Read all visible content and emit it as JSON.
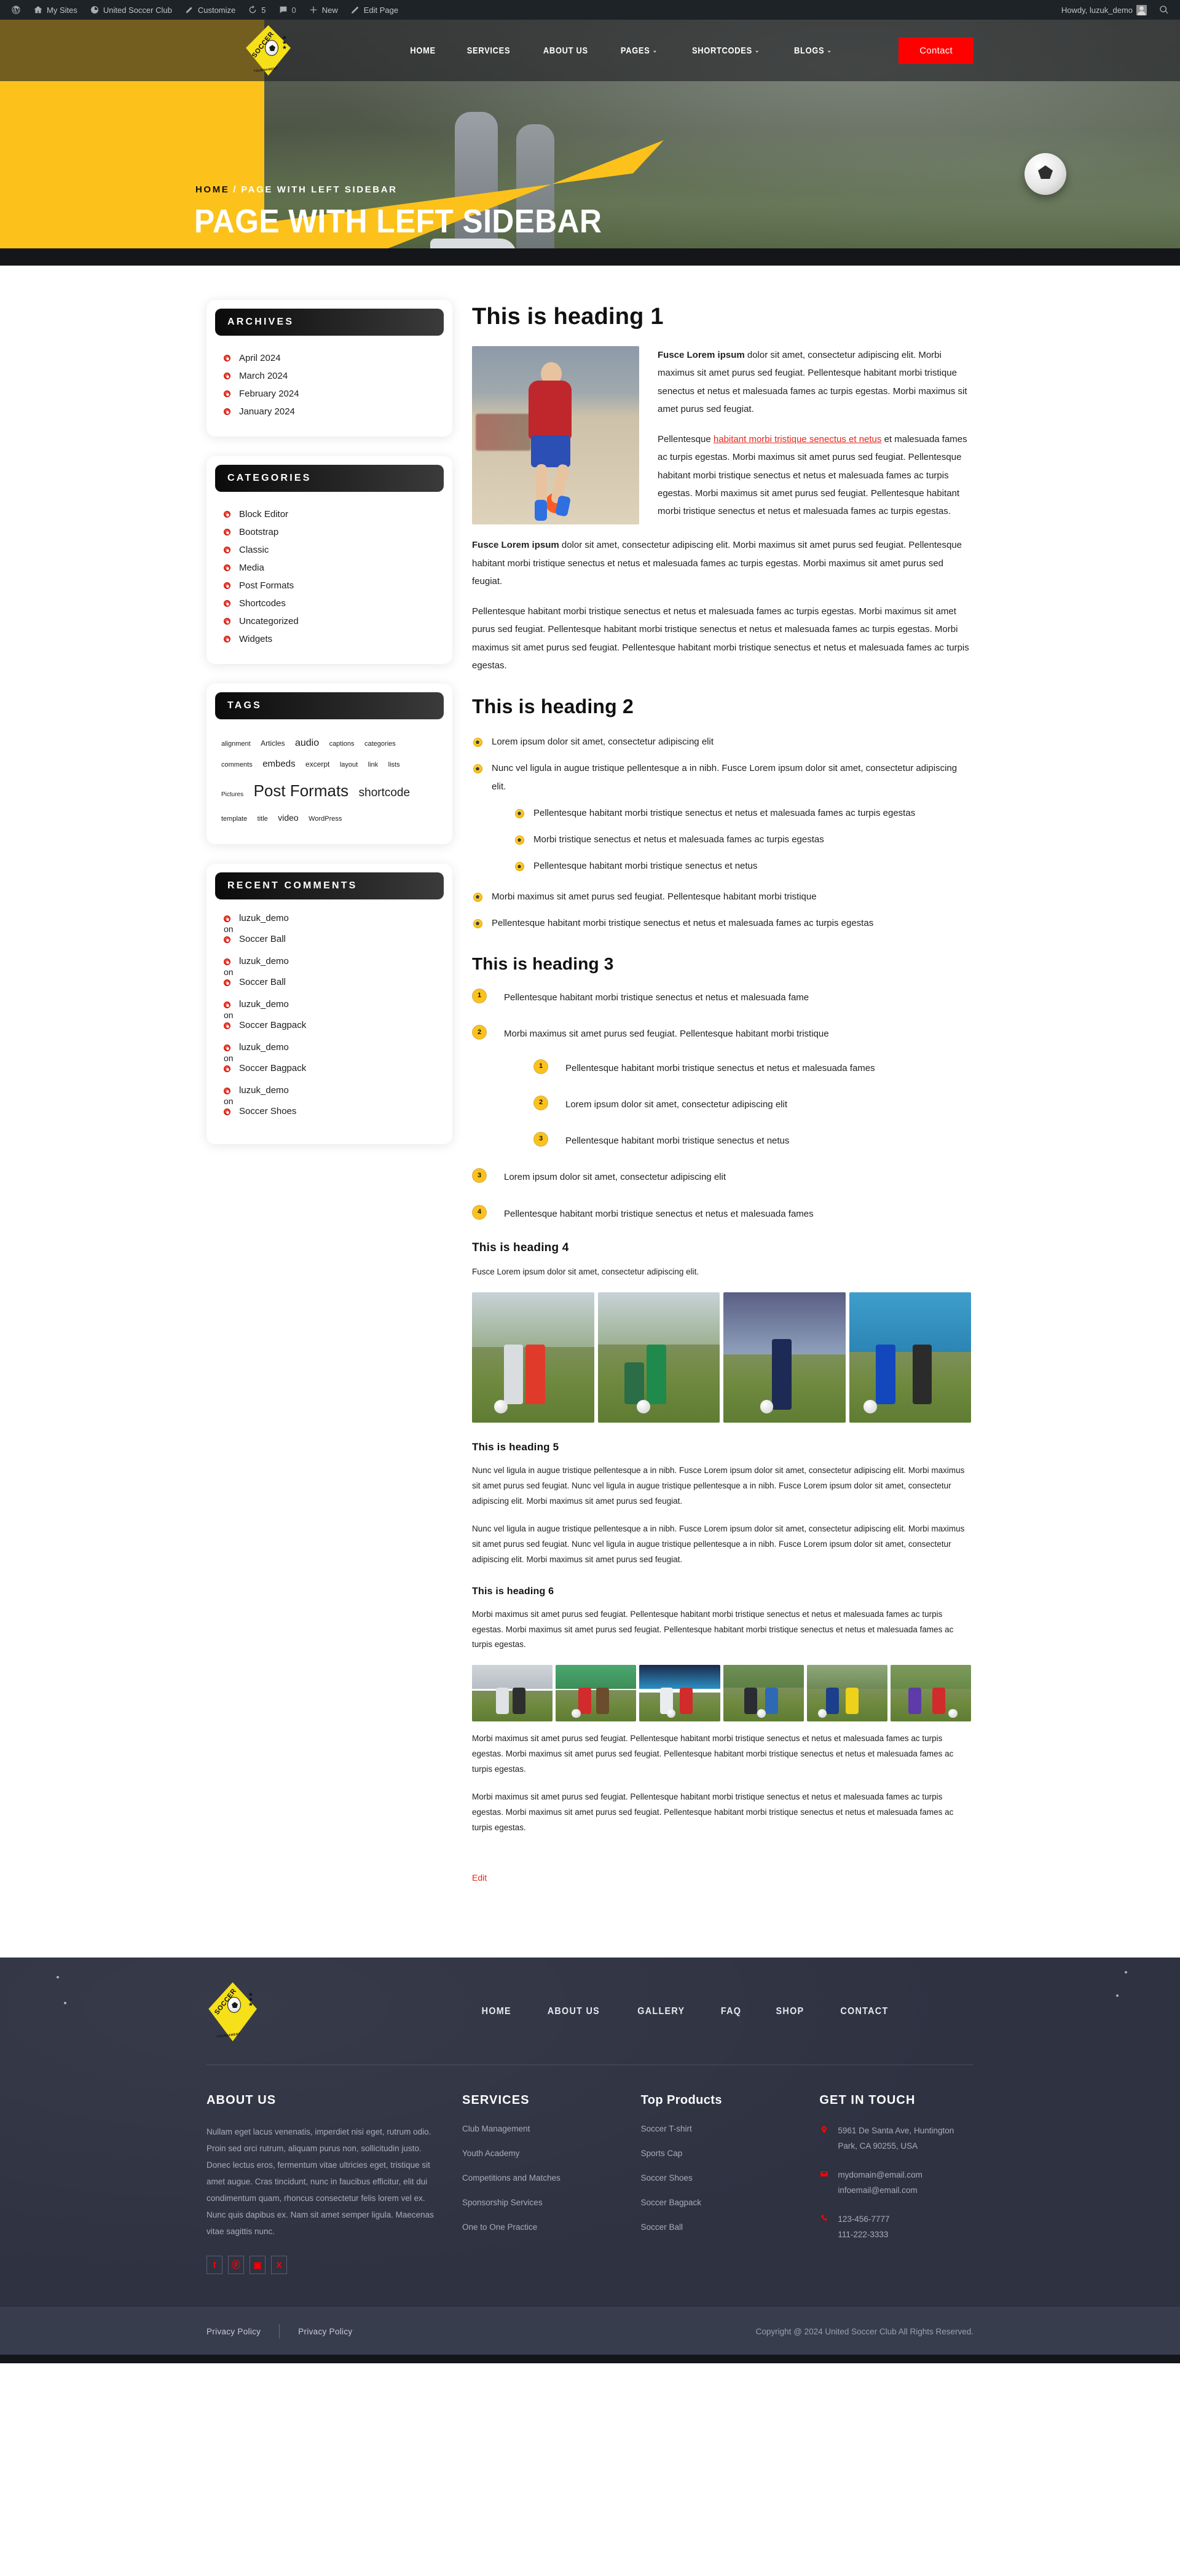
{
  "adminbar": {
    "items": [
      {
        "icon": "wordpress-icon",
        "label": ""
      },
      {
        "icon": "sites-icon",
        "label": "My Sites"
      },
      {
        "icon": "dashboard-icon",
        "label": "United Soccer Club"
      },
      {
        "icon": "customize-icon",
        "label": "Customize"
      },
      {
        "icon": "updates-icon",
        "label": "5"
      },
      {
        "icon": "comments-icon",
        "label": "0"
      },
      {
        "icon": "plus-icon",
        "label": "New"
      },
      {
        "icon": "edit-icon",
        "label": "Edit Page"
      }
    ],
    "howdy": "Howdy, luzuk_demo",
    "search_icon": "search-icon"
  },
  "header": {
    "logo_word": "SOCCER",
    "logo_sub": "TOURNAMENT",
    "nav": [
      {
        "label": "HOME",
        "has_caret": false
      },
      {
        "label": "SERVICES",
        "has_caret": false
      },
      {
        "label": "ABOUT US",
        "has_caret": false
      },
      {
        "label": "PAGES",
        "has_caret": true
      },
      {
        "label": "SHORTCODES",
        "has_caret": true
      },
      {
        "label": "BLOGS",
        "has_caret": true
      }
    ],
    "contact_button": "Contact",
    "accent_red": "#ff0000",
    "accent_yellow": "#fcc21b"
  },
  "hero": {
    "breadcrumb_home": "HOME",
    "breadcrumb_sep": "/",
    "breadcrumb_current": "PAGE WITH LEFT SIDEBAR",
    "title": "PAGE WITH LEFT SIDEBAR"
  },
  "sidebar": {
    "widgets": [
      {
        "title": "ARCHIVES",
        "type": "list",
        "items": [
          "April 2024",
          "March 2024",
          "February 2024",
          "January 2024"
        ]
      },
      {
        "title": "CATEGORIES",
        "type": "list",
        "items": [
          "Block Editor",
          "Bootstrap",
          "Classic",
          "Media",
          "Post Formats",
          "Shortcodes",
          "Uncategorized",
          "Widgets"
        ]
      },
      {
        "title": "TAGS",
        "type": "tagcloud",
        "tags": [
          {
            "label": "alignment",
            "size": 11
          },
          {
            "label": "Articles",
            "size": 12
          },
          {
            "label": "audio",
            "size": 16
          },
          {
            "label": "captions",
            "size": 11
          },
          {
            "label": "categories",
            "size": 11
          },
          {
            "label": "comments",
            "size": 11
          },
          {
            "label": "embeds",
            "size": 15
          },
          {
            "label": "excerpt",
            "size": 12
          },
          {
            "label": "layout",
            "size": 11
          },
          {
            "label": "link",
            "size": 11
          },
          {
            "label": "lists",
            "size": 11
          },
          {
            "label": "Pictures",
            "size": 10
          },
          {
            "label": "Post Formats",
            "size": 26
          },
          {
            "label": "shortcode",
            "size": 19
          },
          {
            "label": "template",
            "size": 11
          },
          {
            "label": "title",
            "size": 11
          },
          {
            "label": "video",
            "size": 14
          },
          {
            "label": "WordPress",
            "size": 11
          }
        ]
      },
      {
        "title": "RECENT COMMENTS",
        "type": "comments",
        "on_word": "on",
        "items": [
          {
            "author": "luzuk_demo",
            "post": "Soccer Ball"
          },
          {
            "author": "luzuk_demo",
            "post": "Soccer Ball"
          },
          {
            "author": "luzuk_demo",
            "post": "Soccer Bagpack"
          },
          {
            "author": "luzuk_demo",
            "post": "Soccer Bagpack"
          },
          {
            "author": "luzuk_demo",
            "post": "Soccer Shoes"
          }
        ]
      }
    ]
  },
  "content": {
    "h1": "This is heading 1",
    "intro_p1_strong": "Fusce Lorem ipsum",
    "intro_p1_rest": " dolor sit amet, consectetur adipiscing elit. Morbi maximus sit amet purus sed feugiat. Pellentesque habitant morbi tristique senectus et netus et malesuada fames ac turpis egestas. Morbi maximus sit amet purus sed feugiat.",
    "intro_p2_a": "Pellentesque ",
    "intro_p2_link": "habitant morbi tristique senectus et netus",
    "intro_p2_b": " et malesuada fames ac turpis egestas. Morbi maximus sit amet purus sed feugiat. Pellentesque habitant morbi tristique senectus et netus et malesuada fames ac turpis egestas. Morbi maximus sit amet purus sed feugiat. Pellentesque habitant morbi tristique senectus et netus et malesuada fames ac turpis egestas.",
    "body_p1_strong": "Fusce Lorem ipsum",
    "body_p1_rest": " dolor sit amet, consectetur adipiscing elit. Morbi maximus sit amet purus sed feugiat. Pellentesque habitant morbi tristique senectus et netus et malesuada fames ac turpis egestas. Morbi maximus sit amet purus sed feugiat.",
    "body_p2": "Pellentesque habitant morbi tristique senectus et netus et malesuada fames ac turpis egestas. Morbi maximus sit amet purus sed feugiat. Pellentesque habitant morbi tristique senectus et netus et malesuada fames ac turpis egestas. Morbi maximus sit amet purus sed feugiat. Pellentesque habitant morbi tristique senectus et netus et malesuada fames ac turpis egestas.",
    "h2": "This is heading 2",
    "ul_items": [
      "Lorem ipsum dolor sit amet, consectetur adipiscing elit",
      "Nunc vel ligula in augue tristique pellentesque a in nibh. Fusce Lorem ipsum dolor sit amet, consectetur adipiscing elit."
    ],
    "ul_nested": [
      "Pellentesque habitant morbi tristique senectus et netus et malesuada fames ac turpis egestas",
      "Morbi tristique senectus et netus et malesuada fames ac turpis egestas",
      "Pellentesque habitant morbi tristique senectus et netus"
    ],
    "ul_items_tail": [
      "Morbi maximus sit amet purus sed feugiat. Pellentesque habitant morbi tristique",
      "Pellentesque habitant morbi tristique senectus et netus et malesuada fames ac turpis egestas"
    ],
    "h3": "This is heading 3",
    "ol_item_1": "Pellentesque habitant morbi tristique senectus et netus et malesuada fame",
    "ol_item_2": "Morbi maximus sit amet purus sed feugiat. Pellentesque habitant morbi tristique",
    "ol_nested": [
      "Pellentesque habitant morbi tristique senectus et netus et malesuada fames",
      "Lorem ipsum dolor sit amet, consectetur adipiscing elit",
      "Pellentesque habitant morbi tristique senectus et netus"
    ],
    "ol_item_3": "Lorem ipsum dolor sit amet, consectetur adipiscing elit",
    "ol_item_4": "Pellentesque habitant morbi tristique senectus et netus et malesuada fames",
    "h4": "This is heading 4",
    "h4_p": "Fusce Lorem ipsum dolor sit amet, consectetur adipiscing elit.",
    "h5": "This is heading 5",
    "h5_p1": "Nunc vel ligula in augue tristique pellentesque a in nibh. Fusce Lorem ipsum dolor sit amet, consectetur adipiscing elit. Morbi maximus sit amet purus sed feugiat. Nunc vel ligula in augue tristique pellentesque a in nibh. Fusce Lorem ipsum dolor sit amet, consectetur adipiscing elit. Morbi maximus sit amet purus sed feugiat.",
    "h5_p2": "Nunc vel ligula in augue tristique pellentesque a in nibh. Fusce Lorem ipsum dolor sit amet, consectetur adipiscing elit. Morbi maximus sit amet purus sed feugiat. Nunc vel ligula in augue tristique pellentesque a in nibh. Fusce Lorem ipsum dolor sit amet, consectetur adipiscing elit. Morbi maximus sit amet purus sed feugiat.",
    "h6": "This is heading 6",
    "h6_p1": "Morbi maximus sit amet purus sed feugiat. Pellentesque habitant morbi tristique senectus et netus et malesuada fames ac turpis egestas. Morbi maximus sit amet purus sed feugiat. Pellentesque habitant morbi tristique senectus et netus et malesuada fames ac turpis egestas.",
    "h6_p2": "Morbi maximus sit amet purus sed feugiat. Pellentesque habitant morbi tristique senectus et netus et malesuada fames ac turpis egestas. Morbi maximus sit amet purus sed feugiat. Pellentesque habitant morbi tristique senectus et netus et malesuada fames ac turpis egestas.",
    "h6_p3": "Morbi maximus sit amet purus sed feugiat. Pellentesque habitant morbi tristique senectus et netus et malesuada fames ac turpis egestas. Morbi maximus sit amet purus sed feugiat. Pellentesque habitant morbi tristique senectus et netus et malesuada fames ac turpis egestas.",
    "edit_link": "Edit"
  },
  "footer": {
    "nav": [
      "HOME",
      "ABOUT US",
      "GALLERY",
      "FAQ",
      "SHOP",
      "CONTACT"
    ],
    "about": {
      "title": "ABOUT US",
      "text": "Nullam eget lacus venenatis, imperdiet nisi eget, rutrum odio. Proin sed orci rutrum, aliquam purus non, sollicitudin justo. Donec lectus eros, fermentum vitae ultricies eget, tristique sit amet augue. Cras tincidunt, nunc in faucibus efficitur, elit dui condimentum quam, rhoncus consectetur felis lorem vel ex. Nunc quis dapibus ex. Nam sit amet semper ligula. Maecenas vitae sagittis nunc."
    },
    "socials": [
      {
        "name": "facebook-icon",
        "glyph": "f"
      },
      {
        "name": "pinterest-icon",
        "glyph": "ⓟ"
      },
      {
        "name": "instagram-icon",
        "glyph": "▣"
      },
      {
        "name": "x-twitter-icon",
        "glyph": "X"
      }
    ],
    "services": {
      "title": "SERVICES",
      "items": [
        "Club Management",
        "Youth Academy",
        "Competitions and Matches",
        "Sponsorship Services",
        "One to One Practice"
      ]
    },
    "products": {
      "title": "Top Products",
      "items": [
        "Soccer T-shirt",
        "Sports Cap",
        "Soccer Shoes",
        "Soccer Bagpack",
        "Soccer Ball"
      ]
    },
    "touch": {
      "title": "GET IN TOUCH",
      "address": "5961 De Santa Ave, Huntington Park, CA 90255, USA",
      "emails": [
        "mydomain@email.com",
        "infoemail@email.com"
      ],
      "phones": [
        "123-456-7777",
        "111-222-3333"
      ]
    },
    "bottom": {
      "link1": "Privacy Policy",
      "link2": "Privacy Policy",
      "copyright": "Copyright @ 2024 United Soccer Club All Rights Reserved."
    }
  }
}
